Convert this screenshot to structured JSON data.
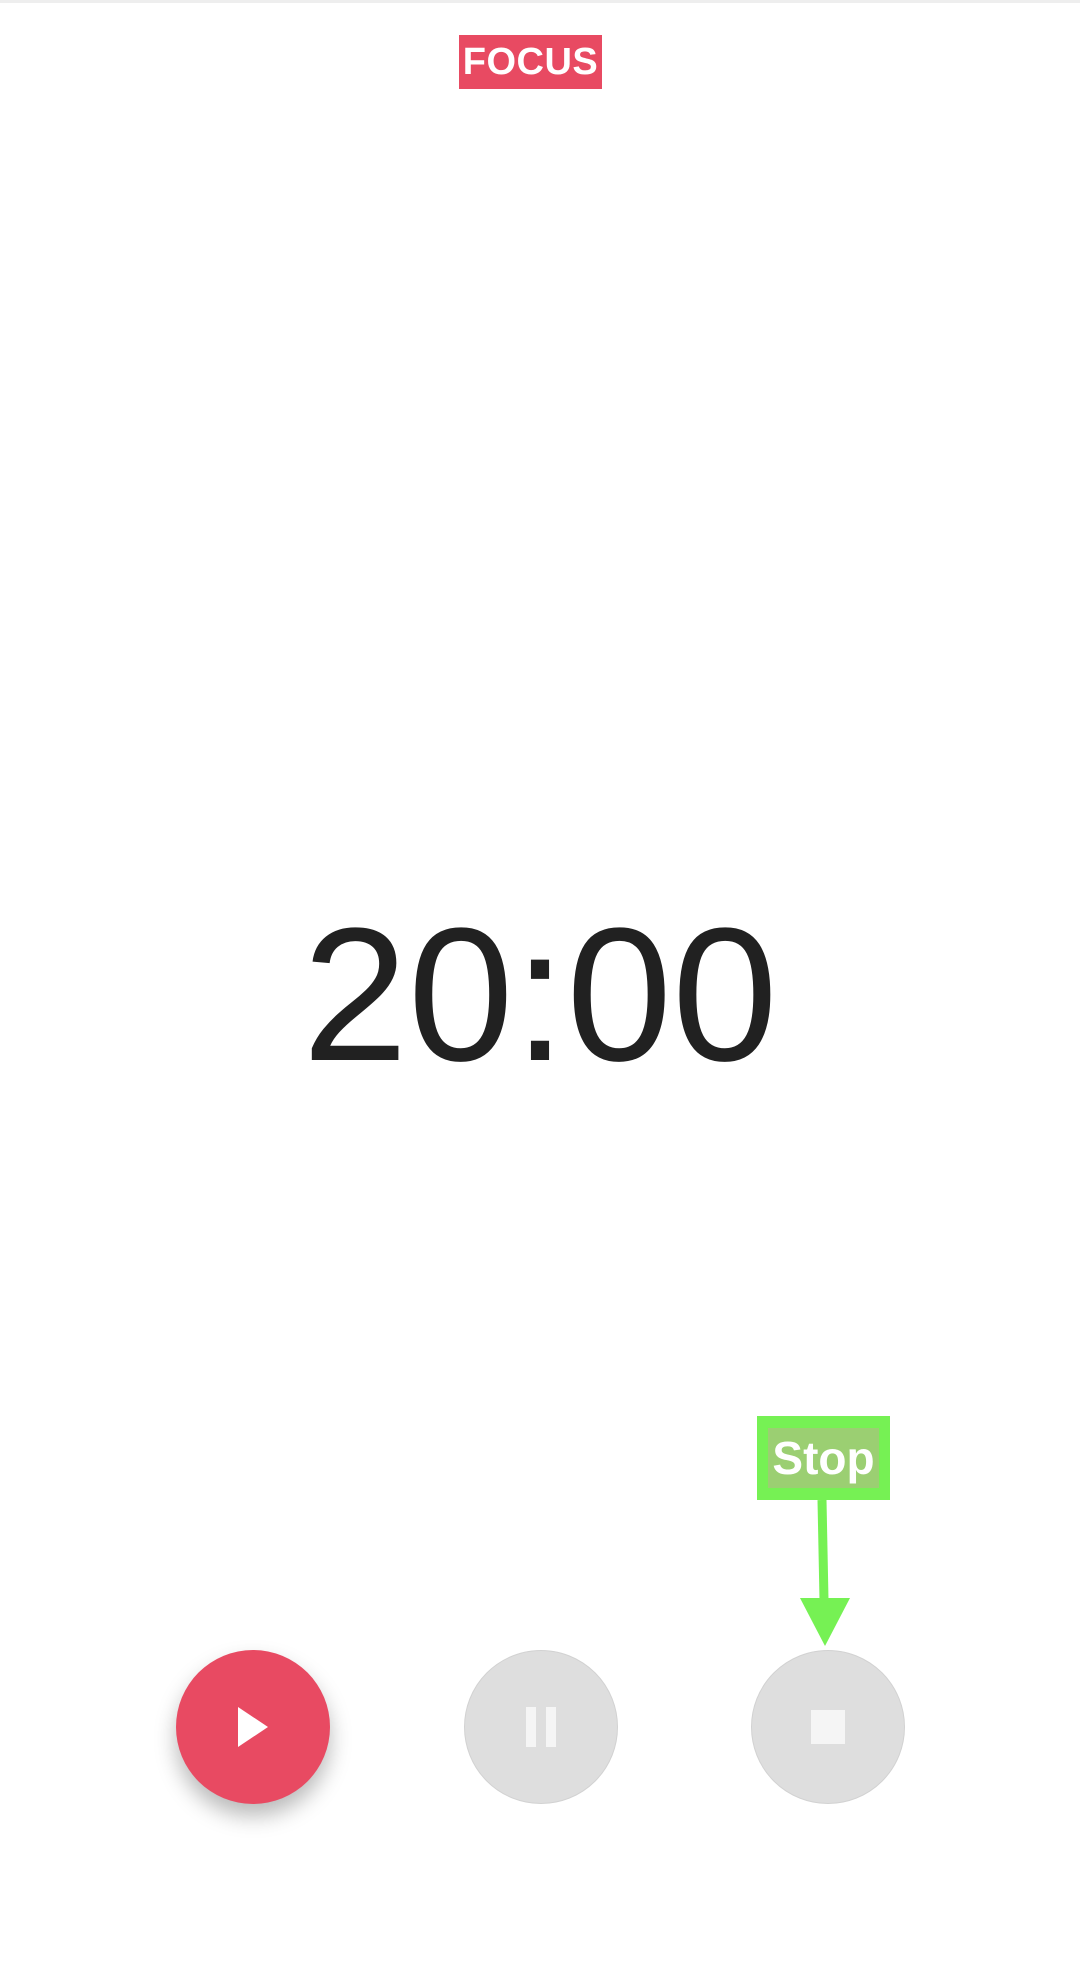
{
  "header": {
    "mode_label": "FOCUS"
  },
  "timer": {
    "display": "20:00"
  },
  "controls": {
    "play_icon": "play-icon",
    "pause_icon": "pause-icon",
    "stop_icon": "stop-icon"
  },
  "annotation": {
    "label": "Stop",
    "color": "#76f154"
  },
  "colors": {
    "accent": "#e84a62",
    "disabled": "#dedede",
    "text": "#212121"
  }
}
